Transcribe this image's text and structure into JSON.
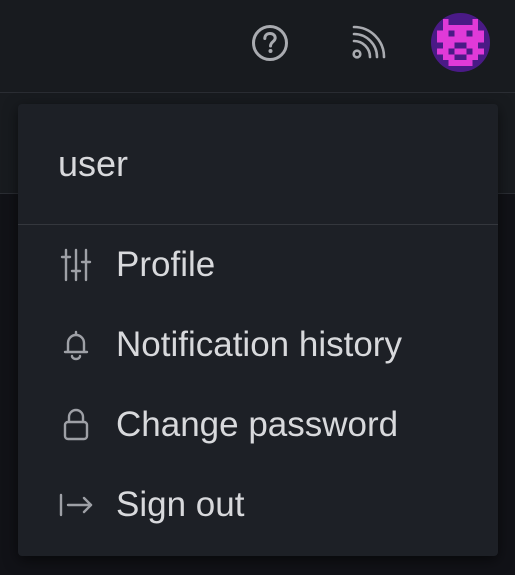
{
  "topbar": {
    "help_icon": "help-circle-icon",
    "rss_icon": "rss-icon",
    "avatar_icon": "user-avatar"
  },
  "menu": {
    "username": "user",
    "items": [
      {
        "label": "Profile",
        "icon": "sliders-icon"
      },
      {
        "label": "Notification history",
        "icon": "bell-icon"
      },
      {
        "label": "Change password",
        "icon": "lock-icon"
      },
      {
        "label": "Sign out",
        "icon": "sign-out-icon"
      }
    ]
  },
  "colors": {
    "background": "#111217",
    "panel": "#1d2026",
    "text": "#d8d9dc",
    "icon": "#9ea0a6",
    "avatar_bg": "#4a1a86",
    "avatar_fg": "#e03ad8"
  }
}
